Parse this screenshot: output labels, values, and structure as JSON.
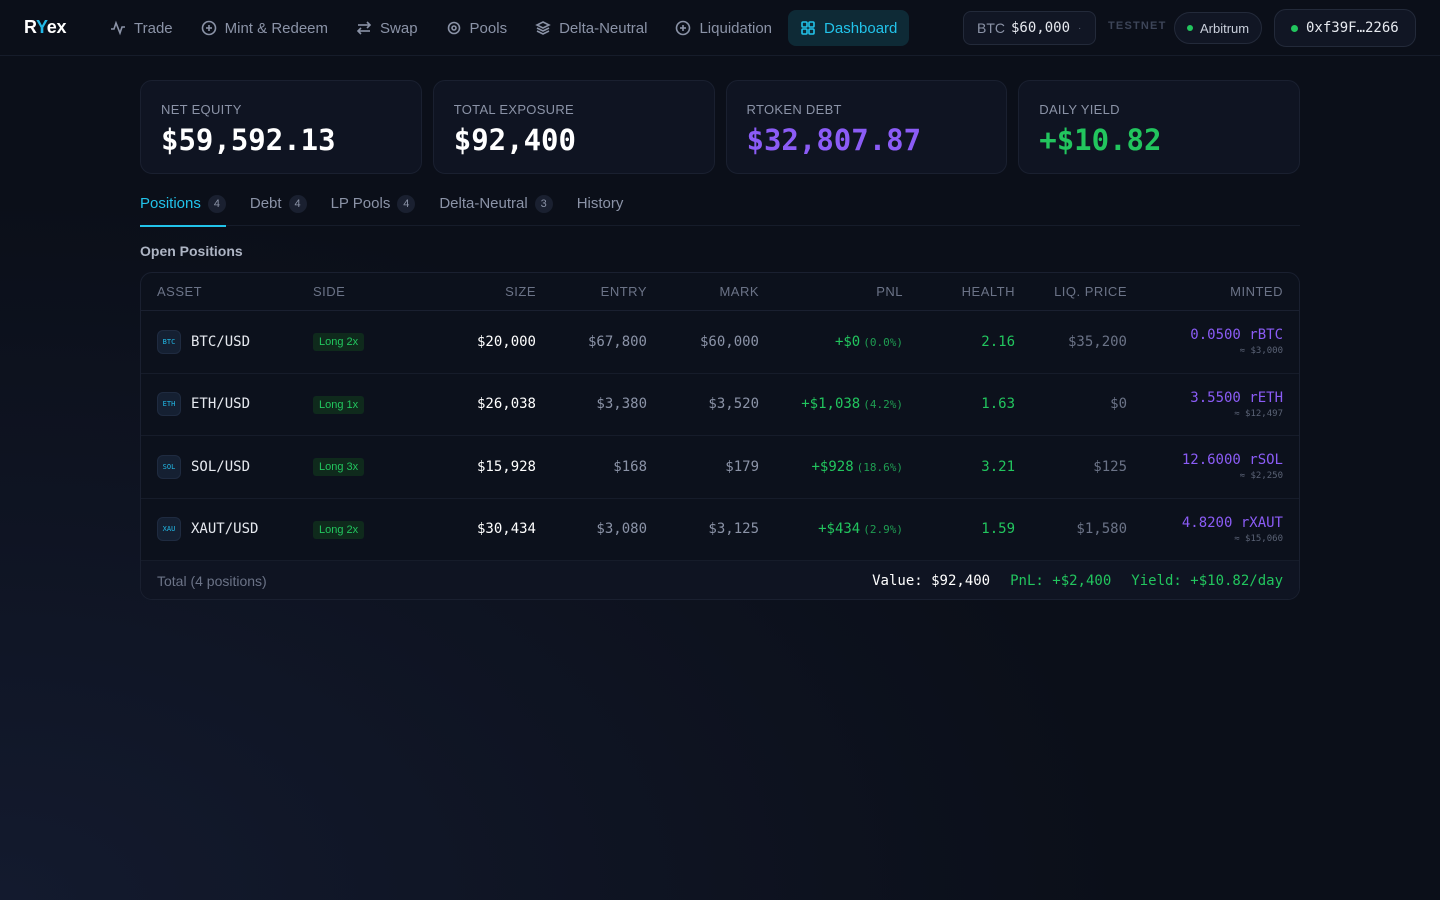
{
  "app": {
    "logo_prefix": "R",
    "logo_y": "Y",
    "logo_suffix": "ex"
  },
  "nav": [
    {
      "label": "Trade",
      "icon": "activity-icon"
    },
    {
      "label": "Mint & Redeem",
      "icon": "plus-circle-icon"
    },
    {
      "label": "Swap",
      "icon": "swap-icon"
    },
    {
      "label": "Pools",
      "icon": "target-icon"
    },
    {
      "label": "Delta-Neutral",
      "icon": "layers-icon"
    },
    {
      "label": "Liquidation",
      "icon": "plus-circle-icon"
    },
    {
      "label": "Dashboard",
      "icon": "grid-icon",
      "active": true
    }
  ],
  "header": {
    "btc_label": "BTC",
    "btc_price": "$60,000",
    "btc_dot": "·",
    "network_tag": "TESTNET",
    "network": "Arbitrum",
    "wallet": "0xf39F…2266"
  },
  "stats": [
    {
      "label": "NET EQUITY",
      "value": "$59,592.13",
      "color": "#ffffff"
    },
    {
      "label": "TOTAL EXPOSURE",
      "value": "$92,400",
      "color": "#ffffff"
    },
    {
      "label": "RTOKEN DEBT",
      "value": "$32,807.87",
      "color": "#8b5cf6"
    },
    {
      "label": "DAILY YIELD",
      "value": "+$10.82",
      "color": "#22c55e"
    }
  ],
  "tabs": [
    {
      "label": "Positions",
      "count": "4",
      "active": true
    },
    {
      "label": "Debt",
      "count": "4"
    },
    {
      "label": "LP Pools",
      "count": "4"
    },
    {
      "label": "Delta-Neutral",
      "count": "3"
    },
    {
      "label": "History",
      "count": ""
    }
  ],
  "section_title": "Open Positions",
  "table": {
    "headers": {
      "asset": "ASSET",
      "side": "SIDE",
      "size": "SIZE",
      "entry": "ENTRY",
      "mark": "MARK",
      "pnl": "PNL",
      "health": "HEALTH",
      "liq": "LIQ. PRICE",
      "minted": "MINTED"
    },
    "rows": [
      {
        "icon": "BTC",
        "asset": "BTC/USD",
        "side": "Long 2x",
        "size": "$20,000",
        "entry": "$67,800",
        "mark": "$60,000",
        "pnl": "+$0",
        "pnl_pct": "(0.0%)",
        "health": "2.16",
        "liq": "$35,200",
        "minted": "0.0500 rBTC",
        "minted_usd": "≈ $3,000"
      },
      {
        "icon": "ETH",
        "asset": "ETH/USD",
        "side": "Long 1x",
        "size": "$26,038",
        "entry": "$3,380",
        "mark": "$3,520",
        "pnl": "+$1,038",
        "pnl_pct": "(4.2%)",
        "health": "1.63",
        "liq": "$0",
        "minted": "3.5500 rETH",
        "minted_usd": "≈ $12,497"
      },
      {
        "icon": "SOL",
        "asset": "SOL/USD",
        "side": "Long 3x",
        "size": "$15,928",
        "entry": "$168",
        "mark": "$179",
        "pnl": "+$928",
        "pnl_pct": "(18.6%)",
        "health": "3.21",
        "liq": "$125",
        "minted": "12.6000 rSOL",
        "minted_usd": "≈ $2,250"
      },
      {
        "icon": "XAU",
        "asset": "XAUT/USD",
        "side": "Long 2x",
        "size": "$30,434",
        "entry": "$3,080",
        "mark": "$3,125",
        "pnl": "+$434",
        "pnl_pct": "(2.9%)",
        "health": "1.59",
        "liq": "$1,580",
        "minted": "4.8200 rXAUT",
        "minted_usd": "≈ $15,060"
      }
    ],
    "footer": {
      "total": "Total (4 positions)",
      "value": "Value: $92,400",
      "pnl": "PnL: +$2,400",
      "yield": "Yield: +$10.82/day"
    }
  },
  "colors": {
    "accent": "#22c3ea",
    "green": "#22c55e",
    "purple": "#8b5cf6",
    "background": "#0b0f19"
  }
}
